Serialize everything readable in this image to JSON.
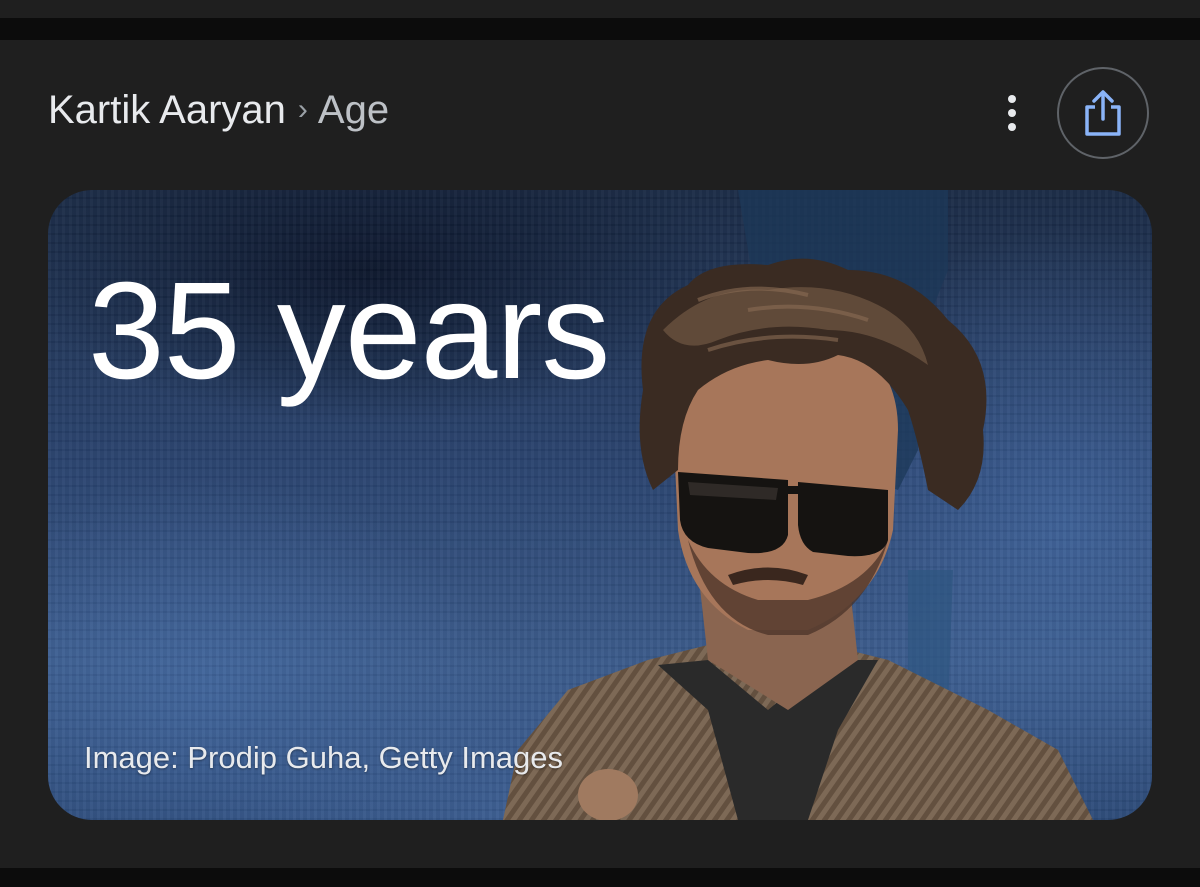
{
  "breadcrumb": {
    "entity": "Kartik Aaryan",
    "separator": "›",
    "attribute": "Age"
  },
  "actions": {
    "more_icon": "more-vert-icon",
    "share_icon": "share-icon"
  },
  "answer_card": {
    "value": "35 years",
    "image_credit": "Image: Prodip Guha, Getty Images"
  },
  "colors": {
    "background": "#1f1f1f",
    "text_primary": "#e8eaed",
    "text_secondary": "#bdc1c6",
    "share_accent": "#8ab4f8",
    "card_blue": "#2a4470"
  }
}
